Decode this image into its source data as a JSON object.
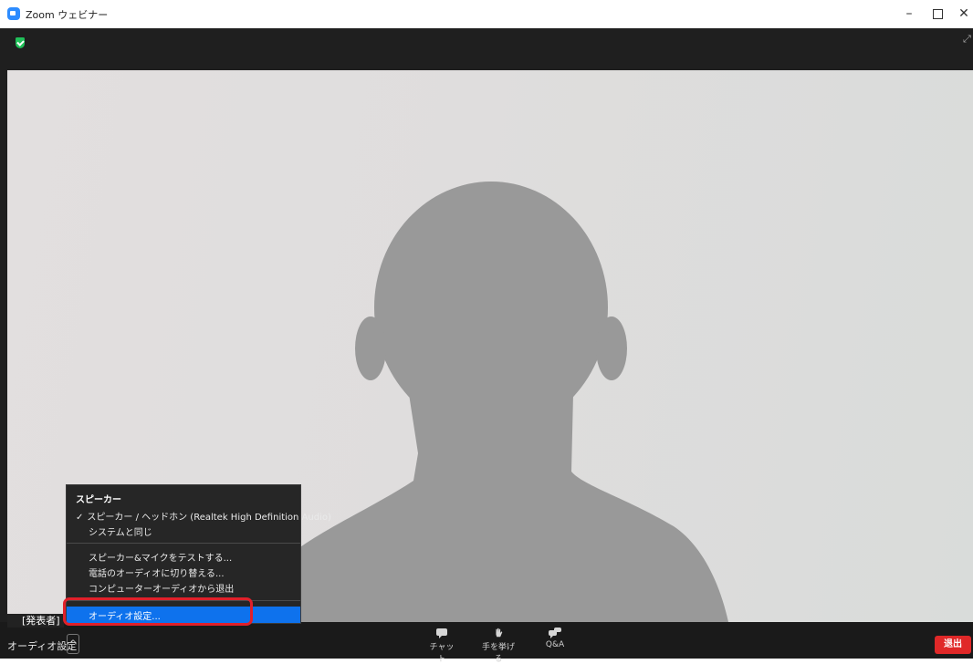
{
  "window": {
    "title": "Zoom ウェビナー",
    "minimize": "–",
    "close": "✕"
  },
  "menu": {
    "heading": "スピーカー",
    "speaker_device": "スピーカー / ヘッドホン (Realtek High Definition Audio)",
    "check": "✓",
    "same_as_system": "システムと同じ",
    "test_speaker_mic": "スピーカー&マイクをテストする...",
    "switch_to_phone": "電話のオーディオに切り替える...",
    "leave_computer_audio": "コンピューターオーディオから退出",
    "audio_settings": "オーディオ設定..."
  },
  "presenter_tag": "[発表者]",
  "toolbar": {
    "audio_settings_label": "オーディオ設定",
    "caret": "^",
    "chat": "チャット",
    "raise_hand": "手を挙げる",
    "qa": "Q&A",
    "leave": "退出"
  },
  "colors": {
    "accent": "#0e72ed",
    "leave": "#e02828",
    "highlight": "#e0202a",
    "secure": "#21c05a"
  }
}
